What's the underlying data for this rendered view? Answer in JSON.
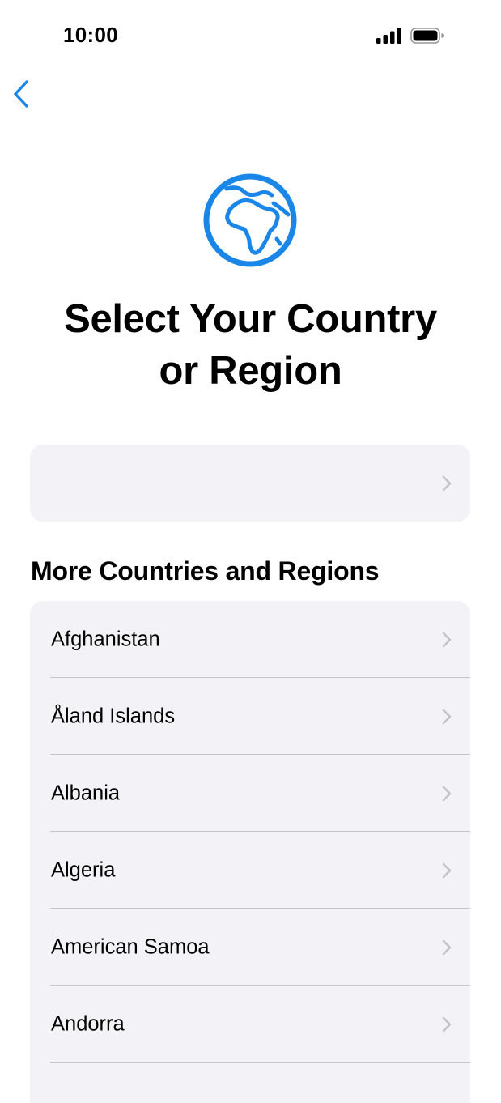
{
  "status_bar": {
    "time": "10:00",
    "signal_icon": "cellular-signal-icon",
    "battery_icon": "battery-full-icon"
  },
  "navigation": {
    "back_icon": "chevron-left-icon"
  },
  "header": {
    "globe_icon": "globe-europe-africa-icon",
    "title_line1": "Select Your Country",
    "title_line2": "or Region"
  },
  "selected_region": {
    "label": "",
    "chevron_icon": "chevron-right-icon"
  },
  "more_regions": {
    "header": "More Countries and Regions",
    "items": [
      {
        "label": "Afghanistan"
      },
      {
        "label": "Åland Islands"
      },
      {
        "label": "Albania"
      },
      {
        "label": "Algeria"
      },
      {
        "label": "American Samoa"
      },
      {
        "label": "Andorra"
      }
    ]
  },
  "colors": {
    "accent": "#1a86e8",
    "card_background": "#f2f2f7",
    "separator": "#c6c6c8",
    "chevron": "#c4c4c7"
  }
}
